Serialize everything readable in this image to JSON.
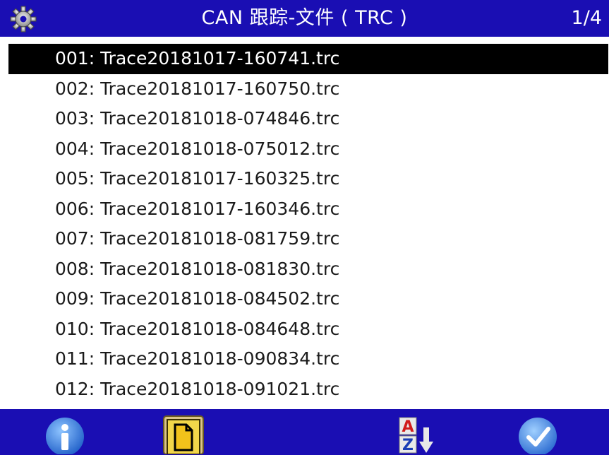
{
  "header": {
    "title": "CAN 跟踪-文件 ( TRC )",
    "pager": "1/4"
  },
  "files": [
    "001: Trace20181017-160741.trc",
    "002: Trace20181017-160750.trc",
    "003: Trace20181018-074846.trc",
    "004: Trace20181018-075012.trc",
    "005: Trace20181017-160325.trc",
    "006: Trace20181017-160346.trc",
    "007: Trace20181018-081759.trc",
    "008: Trace20181018-081830.trc",
    "009: Trace20181018-084502.trc",
    "010: Trace20181018-084648.trc",
    "011: Trace20181018-090834.trc",
    "012: Trace20181018-091021.trc"
  ],
  "selected_index": 0,
  "footer": {
    "icons": [
      "info-icon",
      "file-icon",
      "sort-az-icon",
      "check-icon"
    ]
  },
  "colors": {
    "bar": "#1a0eb3",
    "selection": "#000000",
    "text": "#1b1b1b"
  }
}
